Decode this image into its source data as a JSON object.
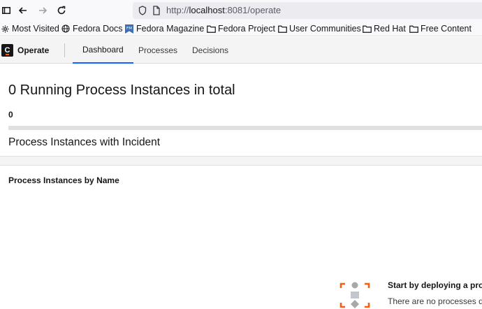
{
  "browser": {
    "url_prefix": "http://",
    "url_host": "localhost",
    "url_rest": ":8081/operate",
    "bookmarks": [
      {
        "label": "Most Visited",
        "icon": "gear-icon"
      },
      {
        "label": "Fedora Docs",
        "icon": "globe-icon"
      },
      {
        "label": "Fedora Magazine",
        "icon": "fedora-magazine-icon"
      },
      {
        "label": "Fedora Project",
        "icon": "folder-icon"
      },
      {
        "label": "User Communities",
        "icon": "folder-icon"
      },
      {
        "label": "Red Hat",
        "icon": "folder-icon"
      },
      {
        "label": "Free Content",
        "icon": "folder-icon"
      }
    ]
  },
  "header": {
    "logo_letter": "C",
    "app_name": "Operate",
    "tabs": [
      {
        "label": "Dashboard",
        "active": true
      },
      {
        "label": "Processes",
        "active": false
      },
      {
        "label": "Decisions",
        "active": false
      }
    ]
  },
  "dashboard": {
    "running_title": "0 Running Process Instances in total",
    "running_count": "0",
    "running_progress_fraction": 0,
    "incident_title": "Process Instances with Incident",
    "by_name_title": "Process Instances by Name",
    "empty_title": "Start by deploying a pro",
    "empty_text": "There are no processes d"
  },
  "colors": {
    "accent": "#0f62fe",
    "brand_orange": "#fc5d0d",
    "icon_gray": "#8d8d8d"
  }
}
